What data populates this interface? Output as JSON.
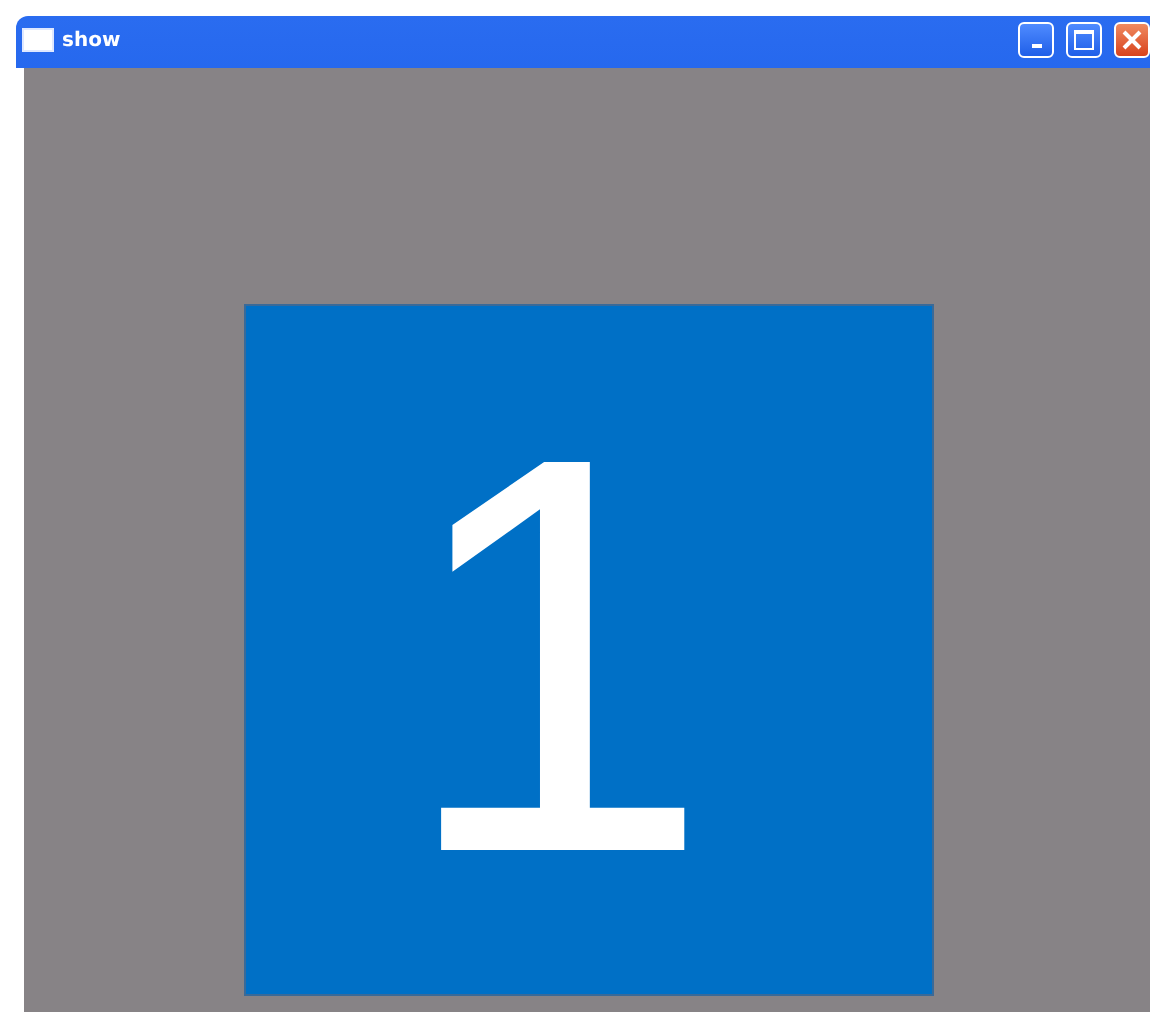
{
  "window": {
    "title": "show"
  },
  "display": {
    "number": "1"
  }
}
